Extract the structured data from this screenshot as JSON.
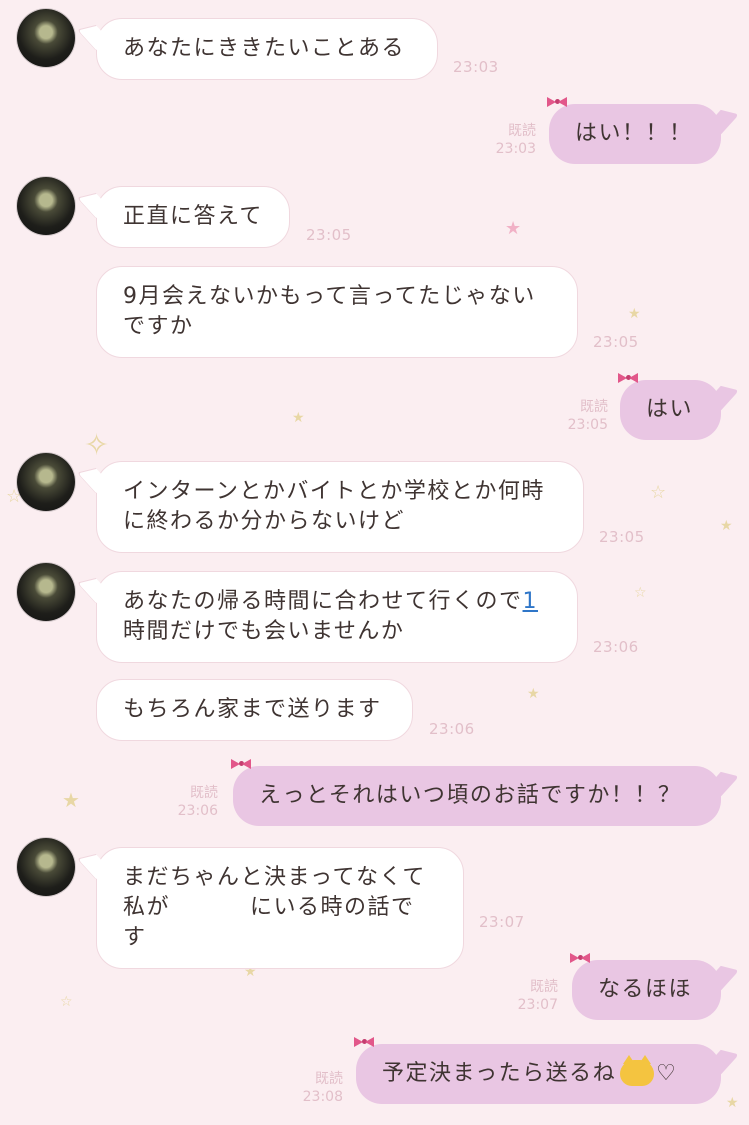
{
  "chat": {
    "messages": [
      {
        "text": "あなたにききたいことある",
        "time": "23:03"
      },
      {
        "text": "はい！！！",
        "read": "既読",
        "time": "23:03"
      },
      {
        "text": "正直に答えて",
        "time": "23:05"
      },
      {
        "line1": "9月会えないかもって言ってたじゃない",
        "line2": "ですか",
        "time": "23:05"
      },
      {
        "text": "はい",
        "read": "既読",
        "time": "23:05"
      },
      {
        "line1": "インターンとかバイトとか学校とか何時",
        "line2": "に終わるか分からないけど",
        "time": "23:05"
      },
      {
        "line1_pre": "あなたの帰る時間に合わせて行くので",
        "line1_link": "1",
        "line2": "時間だけでも会いませんか",
        "time": "23:06"
      },
      {
        "text": "もちろん家まで送ります",
        "time": "23:06"
      },
      {
        "text": "えっとそれはいつ頃のお話ですか！！？",
        "read": "既読",
        "time": "23:06"
      },
      {
        "line1": "まだちゃんと決まってなくて",
        "line2_pre": "私が",
        "line2_post": "にいる時の話です",
        "time": "23:07"
      },
      {
        "text": "なるほほ",
        "read": "既読",
        "time": "23:07"
      },
      {
        "text": "予定決まったら送るね",
        "emoji": "cat-emoji",
        "heart": "♡",
        "read": "既読",
        "time": "23:08"
      }
    ]
  },
  "colors": {
    "background": "#fbeef1",
    "incoming_bubble": "#ffffff",
    "outgoing_bubble": "#e9c6e3",
    "timestamp": "#e2bfc9",
    "link": "#2f76c8",
    "bow": "#e2578a"
  }
}
